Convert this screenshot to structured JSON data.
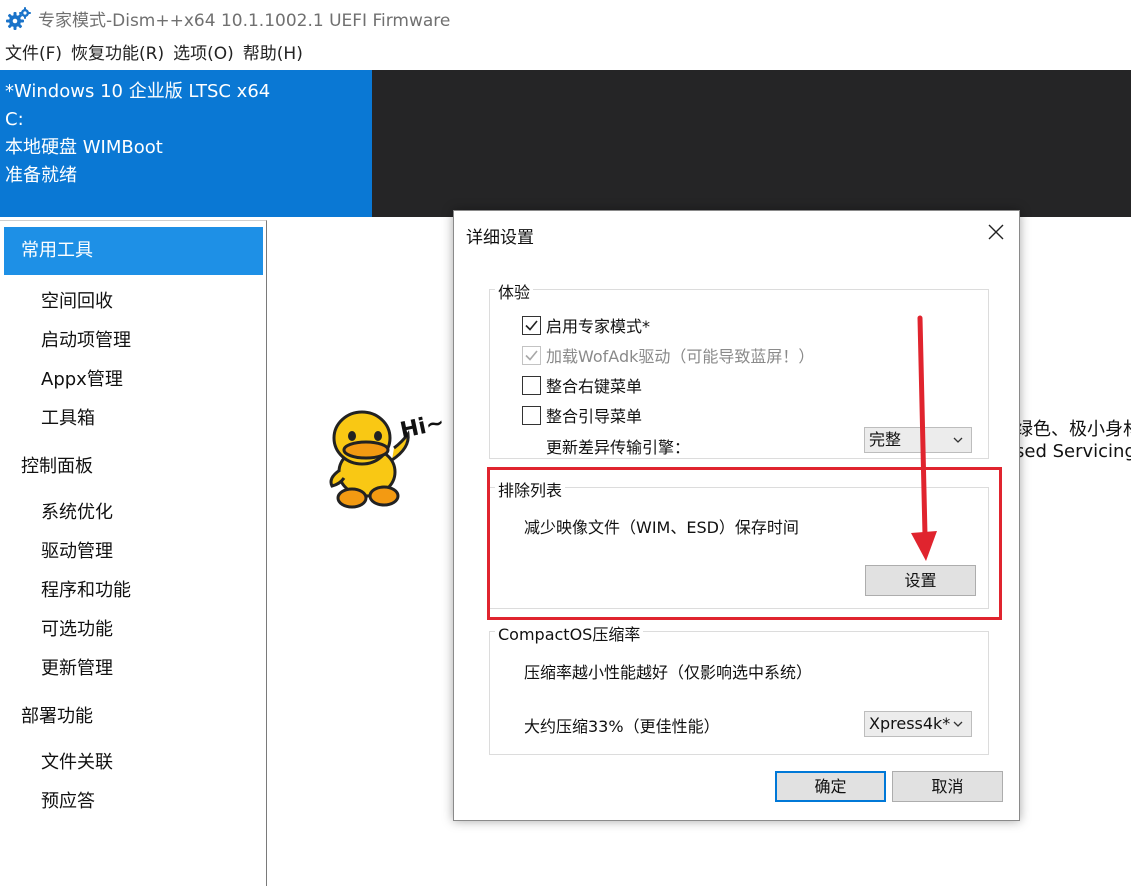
{
  "window": {
    "title": "专家模式-Dism++x64 10.1.1002.1 UEFI Firmware",
    "icon": "gear-icon"
  },
  "menu": [
    "文件(F)",
    "恢复功能(R)",
    "选项(O)",
    "帮助(H)"
  ],
  "info": {
    "line1": "*Windows 10 企业版 LTSC x64",
    "line2": "C:",
    "line3": "本地硬盘 WIMBoot",
    "line4": "准备就绪"
  },
  "sidebar": {
    "active": "常用工具",
    "group1_items": [
      "空间回收",
      "启动项管理",
      "Appx管理",
      "工具箱"
    ],
    "group2": "控制面板",
    "group2_items": [
      "系统优化",
      "驱动管理",
      "程序和功能",
      "可选功能",
      "更新管理"
    ],
    "group3": "部署功能",
    "group3_items": [
      "文件关联",
      "预应答"
    ]
  },
  "background": {
    "text1": "绿色、极小身材",
    "text2": "sed Servicing",
    "duck_text": "Hi~"
  },
  "dialog": {
    "title": "详细设置",
    "experience": {
      "legend": "体验",
      "expert_mode": "启用专家模式*",
      "wofadk": "加载WofAdk驱动（可能导致蓝屏！）",
      "context_menu": "整合右键菜单",
      "boot_menu": "整合引导菜单",
      "diff_engine_label": "更新差异传输引擎：",
      "diff_engine_value": "完整"
    },
    "exclusion": {
      "legend": "排除列表",
      "desc": "减少映像文件（WIM、ESD）保存时间",
      "button": "设置"
    },
    "compact": {
      "legend": "CompactOS压缩率",
      "desc": "压缩率越小性能越好（仅影响选中系统）",
      "ratio_label": "大约压缩33%（更佳性能）",
      "ratio_value": "Xpress4k*"
    },
    "ok": "确定",
    "cancel": "取消"
  },
  "colors": {
    "accent": "#0a78d4",
    "active_item": "#1e90e6",
    "highlight": "#e0242e"
  }
}
